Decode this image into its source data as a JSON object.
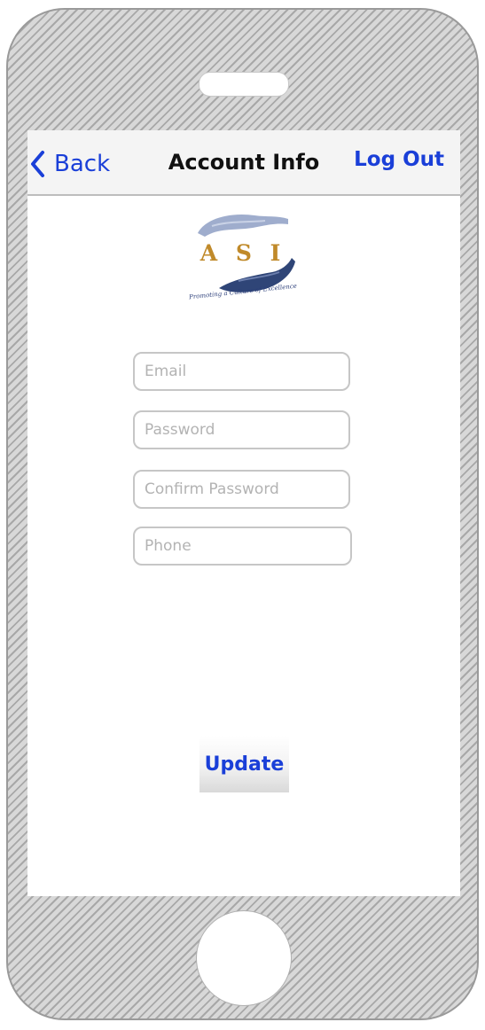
{
  "navbar": {
    "back_label": "Back",
    "title": "Account Info",
    "logout_label": "Log Out"
  },
  "logo": {
    "letters": "A S I",
    "tagline": "Promoting a Culture of Excellence",
    "colors": {
      "gold": "#c08a2a",
      "navy": "#2c3f7a",
      "hand_top": "#8e9fc4",
      "hand_bottom": "#2f4577"
    }
  },
  "form": {
    "email_placeholder": "Email",
    "password_placeholder": "Password",
    "confirm_password_placeholder": "Confirm Password",
    "phone_placeholder": "Phone",
    "email_value": "",
    "password_value": "",
    "confirm_password_value": "",
    "phone_value": ""
  },
  "actions": {
    "update_label": "Update"
  },
  "colors": {
    "accent": "#1a3fd8",
    "navbar_bg": "#f4f4f4",
    "field_border": "#c6c6c6",
    "placeholder": "#b3b3b3"
  }
}
